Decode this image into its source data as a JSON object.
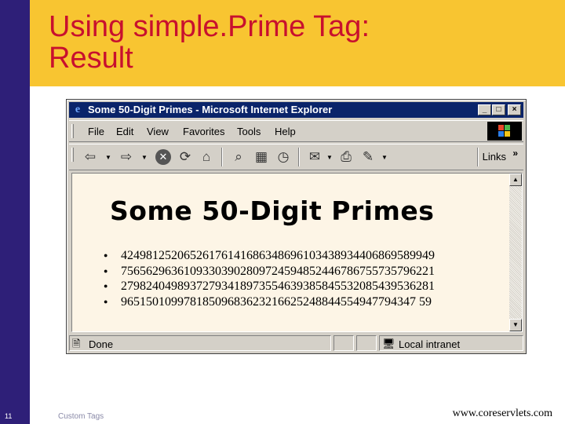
{
  "slide": {
    "title_line1": "Using simple.Prime Tag:",
    "title_line2": "Result",
    "number": "11",
    "footer_center": "Custom Tags",
    "footer_url": "www.coreservlets.com"
  },
  "browser": {
    "title": "Some 50-Digit Primes - Microsoft Internet Explorer",
    "window_buttons": {
      "minimize": "_",
      "maximize": "□",
      "close": "×"
    },
    "menu": [
      "File",
      "Edit",
      "View",
      "Favorites",
      "Tools",
      "Help"
    ],
    "toolbar": {
      "links_label": "Links",
      "links_chevron": "»",
      "icons": [
        "back-icon",
        "forward-icon",
        "stop-icon",
        "refresh-icon",
        "home-icon",
        "search-icon",
        "favorites-icon",
        "history-icon",
        "mail-icon",
        "print-icon",
        "edit-icon"
      ]
    },
    "page": {
      "heading": "Some 50-Digit Primes",
      "primes": [
        "42498125206526176141686348696103438934406869589949",
        "75656296361093303902809724594852446786755735796221",
        "27982404989372793418973554639385845532085439536281",
        "96515010997818509683623216625248844554947794347 59"
      ]
    },
    "status": {
      "text": "Done",
      "zone": "Local intranet"
    }
  },
  "colors": {
    "title_red": "#c8102e",
    "title_bar": "#f8c531",
    "left_bar": "#2e1f78",
    "window_title": "#0a246a"
  }
}
